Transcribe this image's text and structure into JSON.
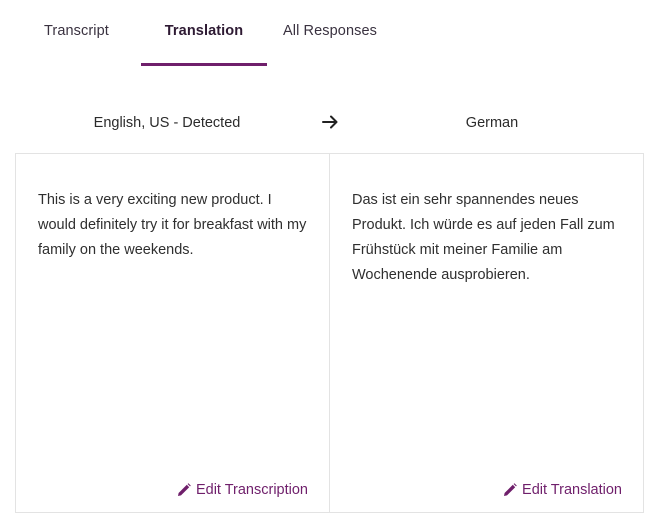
{
  "tabs": [
    {
      "label": "Transcript"
    },
    {
      "label": "Translation"
    },
    {
      "label": "All Responses"
    }
  ],
  "active_tab": "Translation",
  "languages": {
    "source": "English, US - Detected",
    "target": "German"
  },
  "panels": {
    "source_text": "This is a very exciting new product. I would definitely try it for breakfast with my family on the weekends.",
    "target_text": "Das ist ein sehr spannendes neues Produkt. Ich würde es auf jeden Fall zum Frühstück mit meiner Familie am Wochenende ausprobieren.",
    "edit_source_label": "Edit Transcription",
    "edit_target_label": "Edit Translation"
  },
  "colors": {
    "accent": "#6f1f6b",
    "border": "#e3e3e3"
  },
  "icons": {
    "arrow": "arrow-right-icon",
    "edit": "pencil-icon"
  }
}
